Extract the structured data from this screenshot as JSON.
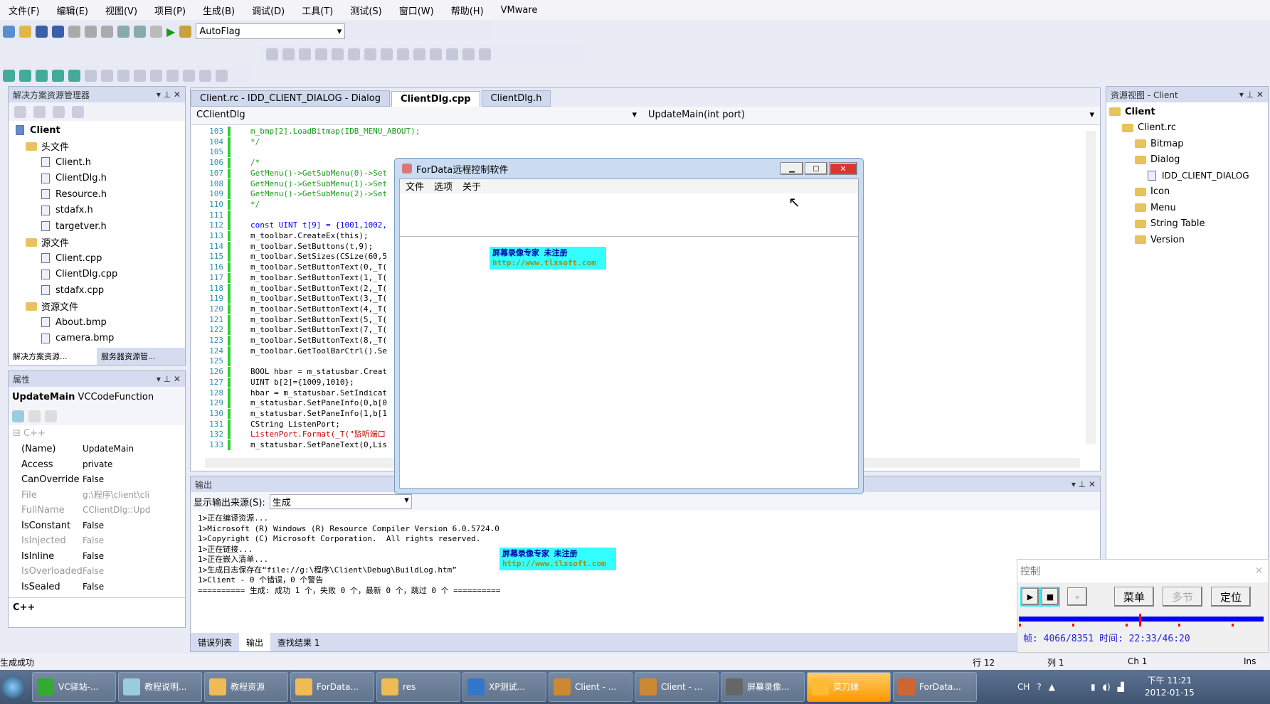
{
  "menu": [
    "文件(F)",
    "编辑(E)",
    "视图(V)",
    "项目(P)",
    "生成(B)",
    "调试(D)",
    "工具(T)",
    "测试(S)",
    "窗口(W)",
    "帮助(H)",
    "VMware"
  ],
  "toolbar": {
    "config_combo": "AutoFlag"
  },
  "solution": {
    "title": "解决方案资源管理器",
    "root": "Client",
    "items": [
      {
        "label": "头文件",
        "type": "folder",
        "level": 1
      },
      {
        "label": "Client.h",
        "type": "file",
        "level": 2
      },
      {
        "label": "ClientDlg.h",
        "type": "file",
        "level": 2
      },
      {
        "label": "Resource.h",
        "type": "file",
        "level": 2
      },
      {
        "label": "stdafx.h",
        "type": "file",
        "level": 2
      },
      {
        "label": "targetver.h",
        "type": "file",
        "level": 2
      },
      {
        "label": "源文件",
        "type": "folder",
        "level": 1
      },
      {
        "label": "Client.cpp",
        "type": "file",
        "level": 2
      },
      {
        "label": "ClientDlg.cpp",
        "type": "file",
        "level": 2
      },
      {
        "label": "stdafx.cpp",
        "type": "file",
        "level": 2
      },
      {
        "label": "资源文件",
        "type": "folder",
        "level": 1
      },
      {
        "label": "About.bmp",
        "type": "file",
        "level": 2
      },
      {
        "label": "camera.bmp",
        "type": "file",
        "level": 2
      }
    ],
    "tabs": [
      "解决方案资源...",
      "服务器资源管..."
    ]
  },
  "properties": {
    "title": "属性",
    "object": "UpdateMain",
    "object_type": "VCCodeFunction",
    "category": "C++",
    "rows": [
      {
        "name": "(Name)",
        "value": "UpdateMain",
        "dim": false
      },
      {
        "name": "Access",
        "value": "private",
        "dim": false
      },
      {
        "name": "CanOverride",
        "value": "False",
        "dim": false
      },
      {
        "name": "File",
        "value": "g:\\程序\\client\\cli",
        "dim": true
      },
      {
        "name": "FullName",
        "value": "CClientDlg::Upd",
        "dim": true
      },
      {
        "name": "IsConstant",
        "value": "False",
        "dim": false
      },
      {
        "name": "IsInjected",
        "value": "False",
        "dim": true
      },
      {
        "name": "IsInline",
        "value": "False",
        "dim": false
      },
      {
        "name": "IsOverloaded",
        "value": "False",
        "dim": true
      },
      {
        "name": "IsSealed",
        "value": "False",
        "dim": false
      }
    ],
    "description": "C++"
  },
  "editor": {
    "tabs": [
      "Client.rc - IDD_CLIENT_DIALOG - Dialog",
      "ClientDlg.cpp",
      "ClientDlg.h"
    ],
    "active_tab": 1,
    "class_combo": "CClientDlg",
    "member_combo": "UpdateMain(int port)",
    "lines": [
      {
        "n": "103",
        "t": "m_bmp[2].LoadBitmap(IDB_MENU_ABOUT);",
        "c": "c"
      },
      {
        "n": "104",
        "t": "*/",
        "c": "c"
      },
      {
        "n": "105",
        "t": "",
        "c": ""
      },
      {
        "n": "106",
        "t": "/*",
        "c": "c"
      },
      {
        "n": "107",
        "t": "GetMenu()->GetSubMenu(0)->Set",
        "c": "c"
      },
      {
        "n": "108",
        "t": "GetMenu()->GetSubMenu(1)->Set",
        "c": "c"
      },
      {
        "n": "109",
        "t": "GetMenu()->GetSubMenu(2)->Set",
        "c": "c"
      },
      {
        "n": "110",
        "t": "*/",
        "c": "c"
      },
      {
        "n": "111",
        "t": "",
        "c": ""
      },
      {
        "n": "112",
        "t": "const UINT t[9] = {1001,1002,",
        "c": "k"
      },
      {
        "n": "113",
        "t": "m_toolbar.CreateEx(this);",
        "c": ""
      },
      {
        "n": "114",
        "t": "m_toolbar.SetButtons(t,9);",
        "c": ""
      },
      {
        "n": "115",
        "t": "m_toolbar.SetSizes(CSize(60,5",
        "c": ""
      },
      {
        "n": "116",
        "t": "m_toolbar.SetButtonText(0,_T(",
        "c": ""
      },
      {
        "n": "117",
        "t": "m_toolbar.SetButtonText(1,_T(",
        "c": ""
      },
      {
        "n": "118",
        "t": "m_toolbar.SetButtonText(2,_T(",
        "c": ""
      },
      {
        "n": "119",
        "t": "m_toolbar.SetButtonText(3,_T(",
        "c": ""
      },
      {
        "n": "120",
        "t": "m_toolbar.SetButtonText(4,_T(",
        "c": ""
      },
      {
        "n": "121",
        "t": "m_toolbar.SetButtonText(5,_T(",
        "c": ""
      },
      {
        "n": "122",
        "t": "m_toolbar.SetButtonText(7,_T(",
        "c": ""
      },
      {
        "n": "123",
        "t": "m_toolbar.SetButtonText(8,_T(",
        "c": ""
      },
      {
        "n": "124",
        "t": "m_toolbar.GetToolBarCtrl().Se",
        "c": ""
      },
      {
        "n": "125",
        "t": "",
        "c": ""
      },
      {
        "n": "126",
        "t": "BOOL hbar = m_statusbar.Creat",
        "c": ""
      },
      {
        "n": "127",
        "t": "UINT b[2]={1009,1010};",
        "c": ""
      },
      {
        "n": "128",
        "t": "hbar = m_statusbar.SetIndicat",
        "c": ""
      },
      {
        "n": "129",
        "t": "m_statusbar.SetPaneInfo(0,b[0",
        "c": ""
      },
      {
        "n": "130",
        "t": "m_statusbar.SetPaneInfo(1,b[1",
        "c": ""
      },
      {
        "n": "131",
        "t": "CString ListenPort;",
        "c": ""
      },
      {
        "n": "132",
        "t": "ListenPort.Format(_T(\"监听端口",
        "c": "s"
      },
      {
        "n": "133",
        "t": "m_statusbar.SetPaneText(0,Lis",
        "c": ""
      }
    ]
  },
  "dialog": {
    "title": "ForData远程控制软件",
    "menu": [
      "文件",
      "选项",
      "关于"
    ]
  },
  "watermark": {
    "line1": "屏幕录像专家      未注册",
    "line2": "http://www.tlxsoft.com"
  },
  "output": {
    "title": "输出",
    "source_label": "显示输出来源(S):",
    "source_value": "生成",
    "lines": [
      "1>正在编译资源...",
      "1>Microsoft (R) Windows (R) Resource Compiler Version 6.0.5724.0",
      "1>Copyright (C) Microsoft Corporation.  All rights reserved.",
      "1>正在链接...",
      "1>正在嵌入清单...",
      "1>生成日志保存在“file://g:\\程序\\Client\\Debug\\BuildLog.htm”",
      "1>Client - 0 个错误，0 个警告",
      "========== 生成: 成功 1 个，失败 0 个，最新 0 个，跳过 0 个 =========="
    ],
    "tabs": [
      "错误列表",
      "输出",
      "查找结果 1"
    ]
  },
  "resource_view": {
    "title": "资源视图 - Client",
    "root": "Client",
    "items": [
      {
        "label": "Client.rc",
        "level": 1
      },
      {
        "label": "Bitmap",
        "level": 2
      },
      {
        "label": "Dialog",
        "level": 2
      },
      {
        "label": "IDD_CLIENT_DIALOG",
        "level": 3
      },
      {
        "label": "Icon",
        "level": 2
      },
      {
        "label": "Menu",
        "level": 2
      },
      {
        "label": "String Table",
        "level": 2
      },
      {
        "label": "Version",
        "level": 2
      }
    ]
  },
  "control": {
    "title": "控制",
    "buttons": [
      "菜单",
      "多节",
      "定位"
    ],
    "progress": 0.487,
    "frame_label": "帧:",
    "frame": "4066/8351",
    "time_label": "时间:",
    "time": "22:33/46:20"
  },
  "statusbar": {
    "message": "生成成功",
    "row": "行 12",
    "col": "列 1",
    "ch": "Ch 1",
    "mode": "Ins"
  },
  "taskbar": {
    "items": [
      "VC驿站-...",
      "教程说明...",
      "教程资源",
      "ForData...",
      "res",
      "XP测试...",
      "Client - ...",
      "Client - ...",
      "屏幕录像...",
      "菜刀妹",
      "ForData..."
    ],
    "tray": "CH",
    "time": "下午 11:21",
    "date": "2012-01-15"
  }
}
